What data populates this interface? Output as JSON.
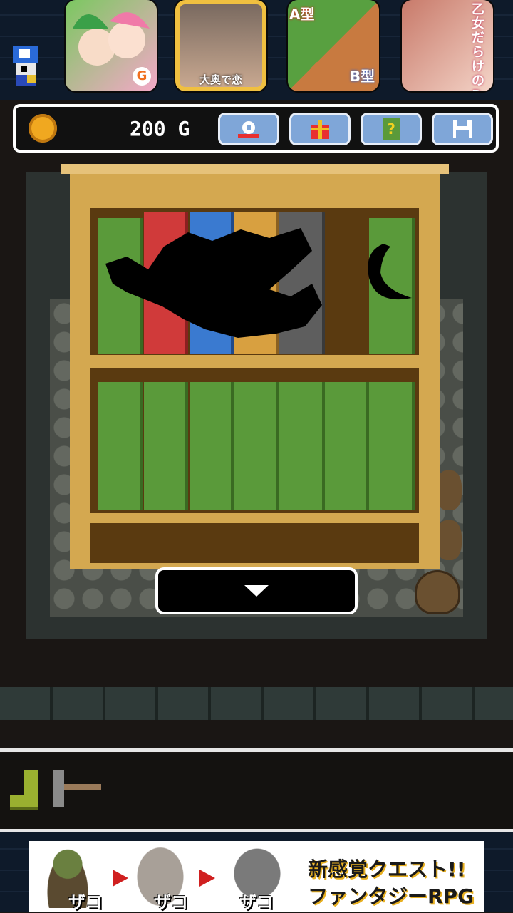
{
  "ads": [
    {
      "name": "ad-icon-1",
      "label": "",
      "badge": "G"
    },
    {
      "name": "ad-icon-2",
      "label": "大奥で恋"
    },
    {
      "name": "ad-icon-3",
      "label_a": "A型",
      "label_b": "B型"
    },
    {
      "name": "ad-icon-4",
      "label": "乙女だらけのRPG"
    }
  ],
  "hud": {
    "gold_amount": "200",
    "gold_unit": "G"
  },
  "toolbar": [
    "hint-icon",
    "gift-icon",
    "help-book-icon",
    "save-icon"
  ],
  "inventory": [
    "boot-icon",
    "hammer-icon"
  ],
  "banner": {
    "zako1": "ザコ",
    "zako2": "ザコ",
    "zako3": "ザコ",
    "line1": "新感覚クエスト!!",
    "line2": "ファンタジーRPG"
  },
  "colors": {
    "book_green": "#5a9a3a",
    "book_red": "#d03a3a",
    "book_blue": "#3a7ad0",
    "book_orange": "#d8a040",
    "book_gray": "#5e5e5e",
    "accent": "#7fa6d8"
  }
}
